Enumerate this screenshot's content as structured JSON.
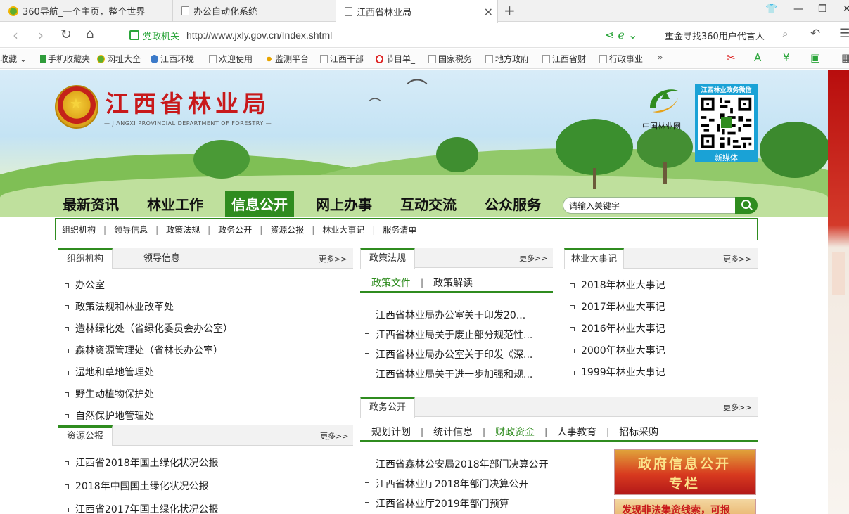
{
  "browser": {
    "tabs": [
      {
        "title": "360导航_一个主页，整个世界"
      },
      {
        "title": "办公自动化系统"
      },
      {
        "title": "江西省林业局"
      }
    ],
    "newtab_glyph": "+",
    "close_glyph": "×",
    "address": {
      "badge": "党政机关",
      "url": "http://www.jxly.gov.cn/Index.shtml",
      "side_text": "重金寻找360用户代言人"
    },
    "bookmarks": [
      "收藏",
      "手机收藏夹",
      "网址大全",
      "江西环境",
      "欢迎使用",
      "监测平台",
      "江西干部",
      "节目单_",
      "国家税务",
      "地方政府",
      "江西省财",
      "行政事业"
    ],
    "bookmarks_more": "»"
  },
  "site": {
    "title": "江西省林业局",
    "subtitle": "— JIANGXI PROVINCIAL DEPARTMENT OF FORESTRY —",
    "forestnet_label": "中国林业网",
    "qr_title": "江西林业政务微信",
    "qr_foot": "新媒体",
    "nav": [
      "最新资讯",
      "林业工作",
      "信息公开",
      "网上办事",
      "互动交流",
      "公众服务"
    ],
    "search_value": "请输入关键字",
    "subnav": [
      "组织机构",
      "领导信息",
      "政策法规",
      "政务公开",
      "资源公报",
      "林业大事记",
      "服务清单"
    ]
  },
  "panels": {
    "org": {
      "tab_active": "组织机构",
      "tab_other": "领导信息",
      "more": "更多>>",
      "items": [
        "办公室",
        "政策法规和林业改革处",
        "造林绿化处（省绿化委员会办公室）",
        "森林资源管理处（省林长办公室）",
        "湿地和草地管理处",
        "野生动植物保护处",
        "自然保护地管理处"
      ]
    },
    "resource": {
      "tab_active": "资源公报",
      "more": "更多>>",
      "items": [
        "江西省2018年国土绿化状况公报",
        "2018年中国国土绿化状况公报",
        "江西省2017年国土绿化状况公报"
      ]
    },
    "policy": {
      "tab_active": "政策法规",
      "more": "更多>>",
      "subtabs": [
        "政策文件",
        "政策解读"
      ],
      "items": [
        "江西省林业局办公室关于印发20...",
        "江西省林业局关于废止部分规范性...",
        "江西省林业局办公室关于印发《深...",
        "江西省林业局关于进一步加强和规..."
      ]
    },
    "events": {
      "tab_active": "林业大事记",
      "more": "更多>>",
      "items": [
        "2018年林业大事记",
        "2017年林业大事记",
        "2016年林业大事记",
        "2000年林业大事记",
        "1999年林业大事记"
      ]
    },
    "affairs": {
      "tab_active": "政务公开",
      "more": "更多>>",
      "subtabs": [
        "规划计划",
        "统计信息",
        "财政资金",
        "人事教育",
        "招标采购"
      ],
      "items": [
        "江西省森林公安局2018年部门决算公开",
        "江西省林业厅2018年部门决算公开",
        "江西省林业厅2019年部门预算"
      ]
    }
  },
  "promos": {
    "gov_info": "政府信息公开专栏",
    "illegal_funds": "发现非法集资线索，可报"
  },
  "colors": {
    "brand_green": "#2f8c1f",
    "title_red": "#c8191b",
    "qr_blue": "#1aa2d6"
  }
}
